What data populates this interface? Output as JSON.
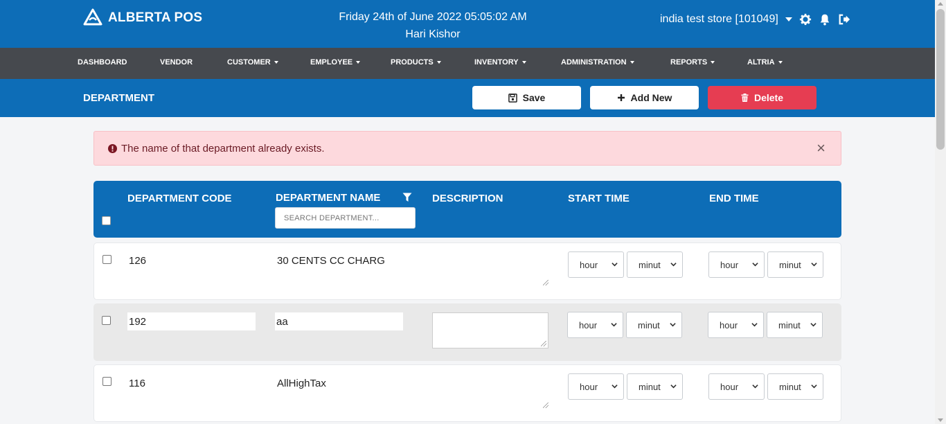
{
  "header": {
    "brand": "ALBERTA POS",
    "date": "Friday 24th of June 2022 05:05:02 AM",
    "user": "Hari Kishor",
    "store": "india test store [101049]"
  },
  "nav": {
    "items": [
      {
        "label": "DASHBOARD",
        "dropdown": false
      },
      {
        "label": "VENDOR",
        "dropdown": false
      },
      {
        "label": "CUSTOMER",
        "dropdown": true
      },
      {
        "label": "EMPLOYEE",
        "dropdown": true
      },
      {
        "label": "PRODUCTS",
        "dropdown": true
      },
      {
        "label": "INVENTORY",
        "dropdown": true
      },
      {
        "label": "ADMINISTRATION",
        "dropdown": true
      },
      {
        "label": "REPORTS",
        "dropdown": true
      },
      {
        "label": "ALTRIA",
        "dropdown": true
      }
    ]
  },
  "page": {
    "title": "DEPARTMENT",
    "save_label": "Save",
    "add_label": "Add New",
    "delete_label": "Delete"
  },
  "alert": {
    "message": "The name of that department already exists.",
    "close": "×"
  },
  "table": {
    "columns": {
      "code": "DEPARTMENT CODE",
      "name": "DEPARTMENT NAME",
      "description": "DESCRIPTION",
      "start": "START TIME",
      "end": "END TIME"
    },
    "search_placeholder": "SEARCH DEPARTMENT...",
    "rows": [
      {
        "code": "126",
        "name": "30 CENTS CC CHARG",
        "description": "",
        "start_hour": "hour",
        "start_minute": "minut",
        "end_hour": "hour",
        "end_minute": "minut"
      },
      {
        "code": "192",
        "name": "aa",
        "description": "",
        "start_hour": "hour",
        "start_minute": "minut",
        "end_hour": "hour",
        "end_minute": "minut"
      },
      {
        "code": "116",
        "name": "AllHighTax",
        "description": "",
        "start_hour": "hour",
        "start_minute": "minut",
        "end_hour": "hour",
        "end_minute": "minut"
      }
    ]
  },
  "colors": {
    "primary": "#0d6db7",
    "nav": "#46494e",
    "danger": "#e63d52",
    "alert_bg": "#fdd9dd"
  }
}
